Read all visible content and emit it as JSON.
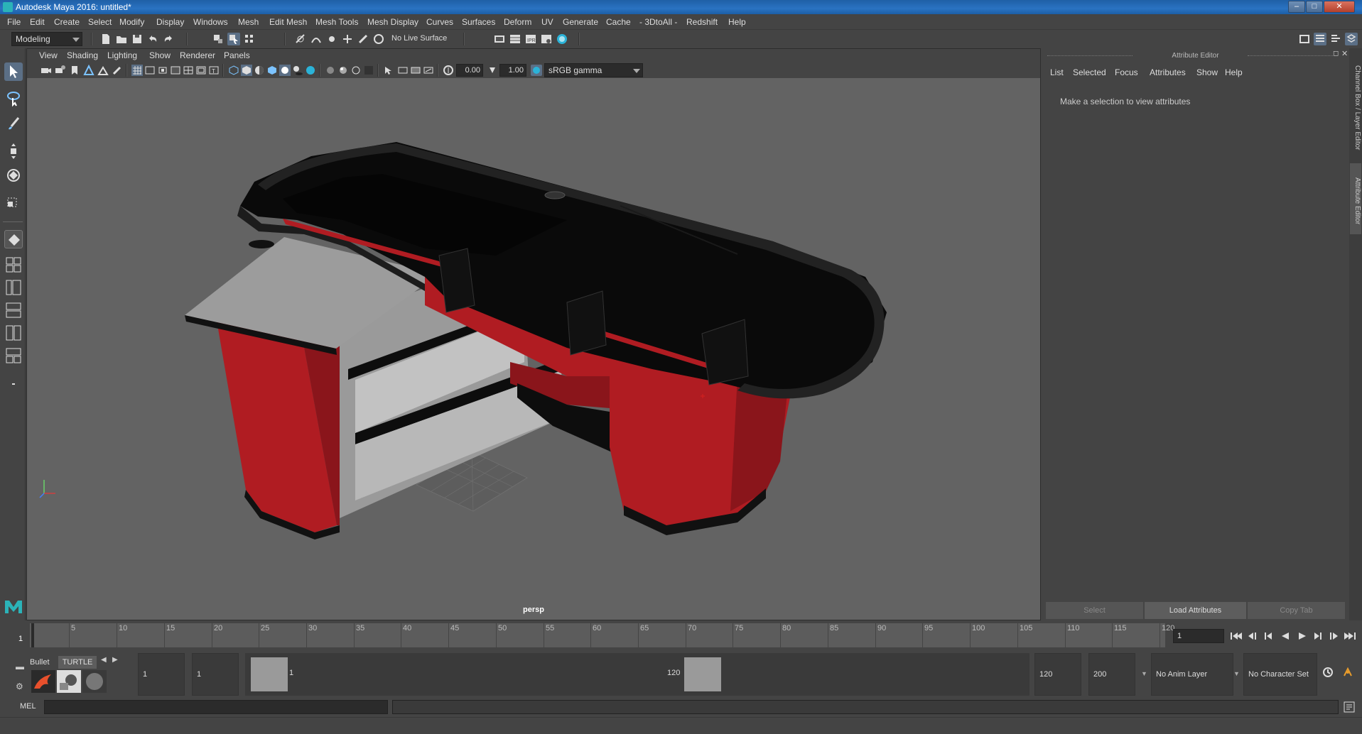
{
  "window": {
    "title": "Autodesk Maya 2016: untitled*"
  },
  "menubar": [
    "File",
    "Edit",
    "Create",
    "Select",
    "Modify",
    "Display",
    "Windows",
    "Mesh",
    "Edit Mesh",
    "Mesh Tools",
    "Mesh Display",
    "Curves",
    "Surfaces",
    "Deform",
    "UV",
    "Generate",
    "Cache",
    "- 3DtoAll -",
    "Redshift",
    "Help"
  ],
  "statusline": {
    "mode": "Modeling",
    "live_surface": "No Live Surface"
  },
  "panel": {
    "menu": [
      "View",
      "Shading",
      "Lighting",
      "Show",
      "Renderer",
      "Panels"
    ],
    "near_value": "0.00",
    "far_value": "1.00",
    "color_space": "sRGB gamma",
    "camera": "persp"
  },
  "attribute_editor": {
    "header": "Attribute Editor",
    "menu": [
      "List",
      "Selected",
      "Focus",
      "Attributes",
      "Show",
      "Help"
    ],
    "message": "Make a selection to view attributes",
    "buttons": {
      "select": "Select",
      "load": "Load Attributes",
      "copy": "Copy Tab"
    },
    "side_tabs": [
      "Channel Box / Layer Editor",
      "Attribute Editor"
    ]
  },
  "timeslider": {
    "labels": [
      "5",
      "10",
      "15",
      "20",
      "25",
      "30",
      "35",
      "40",
      "45",
      "50",
      "55",
      "60",
      "65",
      "70",
      "75",
      "80",
      "85",
      "90",
      "95",
      "100",
      "105",
      "110",
      "115",
      "120"
    ],
    "start_label": "1",
    "current_frame": "1"
  },
  "rangeslider": {
    "shelf_tabs": [
      "Bullet",
      "TURTLE"
    ],
    "start_time": "1",
    "playback_start": "1",
    "range_start": "1",
    "range_end": "120",
    "playback_end": "120",
    "end_time": "200",
    "anim_layer": "No Anim Layer",
    "character_set": "No Character Set"
  },
  "cmdline": {
    "label": "MEL"
  },
  "colors": {
    "counter_red": "#b01c22",
    "counter_black": "#0a0a0a",
    "counter_gray": "#9a9a9a",
    "viewport_bg": "#636363"
  }
}
